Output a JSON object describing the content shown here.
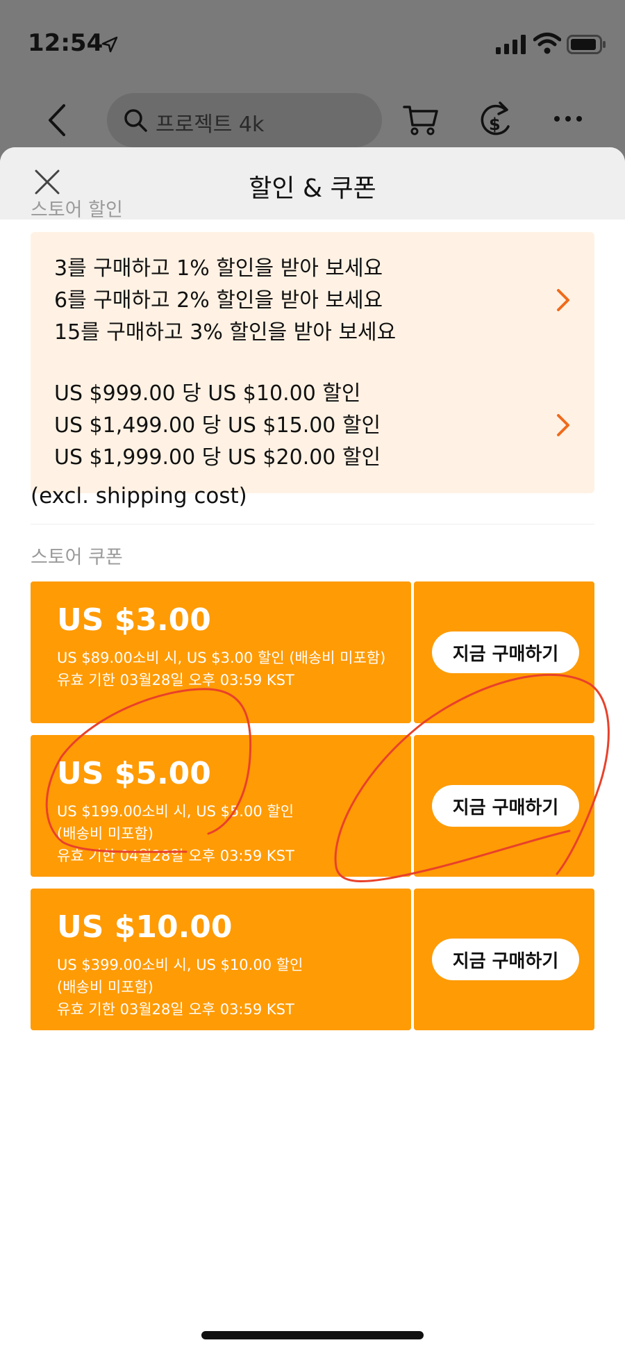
{
  "status_bar": {
    "time": "12:54"
  },
  "header": {
    "search_placeholder": "프로젝트 4k"
  },
  "sheet": {
    "title": "할인 & 쿠폰",
    "store_discount_label": "스토어 할인",
    "quantity_promo": [
      "3를 구매하고 1% 할인을 받아 보세요",
      "6를 구매하고 2% 할인을 받아 보세요",
      "15를 구매하고 3% 할인을 받아 보세요"
    ],
    "amount_promo": [
      "US $999.00 당 US $10.00 할인",
      "US $1,499.00 당 US $15.00 할인",
      "US $1,999.00 당 US $20.00 할인"
    ],
    "excl_note": "(excl. shipping cost)",
    "store_coupon_label": "스토어 쿠폰",
    "coupons": [
      {
        "amount": "US $3.00",
        "lines": [
          "US $89.00소비 시, US $3.00 할인 (배송비 미포함)",
          "유효 기한 03월28일 오후 03:59 KST"
        ],
        "button": "지금 구매하기"
      },
      {
        "amount": "US $5.00",
        "lines": [
          "US $199.00소비 시, US $5.00 할인",
          "(배송비 미포함)",
          "유효 기한 04월28일 오후 03:59 KST"
        ],
        "button": "지금 구매하기"
      },
      {
        "amount": "US $10.00",
        "lines": [
          "US $399.00소비 시, US $10.00 할인",
          "(배송비 미포함)",
          "유효 기한 03월28일 오후 03:59 KST"
        ],
        "button": "지금 구매하기"
      }
    ]
  },
  "colors": {
    "coupon_orange": "#ff9b05",
    "promo_background": "#fff2e4",
    "chevron_orange": "#f06a1c",
    "annotation_red": "#e8412b"
  }
}
